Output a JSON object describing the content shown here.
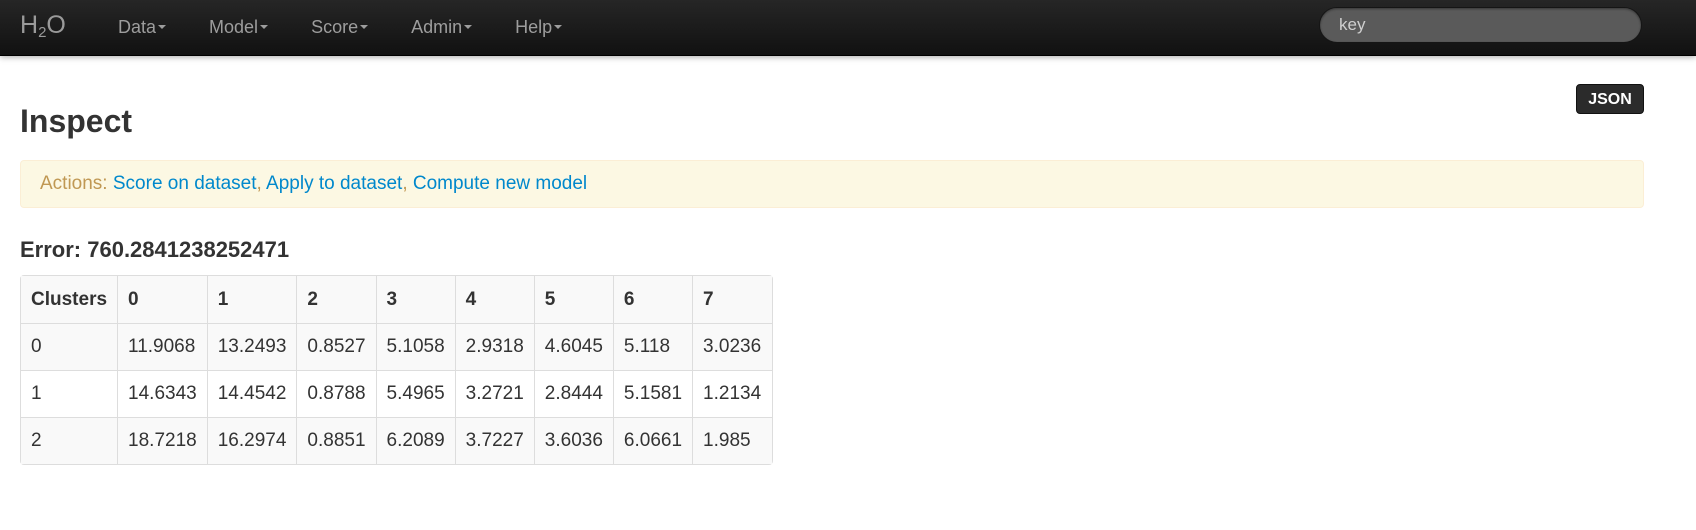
{
  "navbar": {
    "brand": "H",
    "brand_sub": "2",
    "brand_tail": "O",
    "menus": [
      {
        "label": "Data"
      },
      {
        "label": "Model"
      },
      {
        "label": "Score"
      },
      {
        "label": "Admin"
      },
      {
        "label": "Help"
      }
    ],
    "search": {
      "placeholder": "key"
    }
  },
  "toolbar": {
    "json_label": "JSON"
  },
  "page": {
    "title": "Inspect"
  },
  "actions": {
    "prefix": "Actions:",
    "links": [
      "Score on dataset",
      "Apply to dataset",
      "Compute new model"
    ],
    "separator": ","
  },
  "error": {
    "text": "Error: 760.2841238252471"
  },
  "table": {
    "columns": [
      "Clusters",
      "0",
      "1",
      "2",
      "3",
      "4",
      "5",
      "6",
      "7"
    ],
    "rows": [
      [
        "0",
        "11.9068",
        "13.2493",
        "0.8527",
        "5.1058",
        "2.9318",
        "4.6045",
        "5.118",
        "3.0236"
      ],
      [
        "1",
        "14.6343",
        "14.4542",
        "0.8788",
        "5.4965",
        "3.2721",
        "2.8444",
        "5.1581",
        "1.2134"
      ],
      [
        "2",
        "18.7218",
        "16.2974",
        "0.8851",
        "6.2089",
        "3.7227",
        "3.6036",
        "6.0661",
        "1.985"
      ]
    ]
  },
  "colors": {
    "navbar_bg": "#1b1b1b",
    "link": "#0088cc",
    "alert_bg": "#fcf8e3",
    "alert_text": "#c09853"
  }
}
